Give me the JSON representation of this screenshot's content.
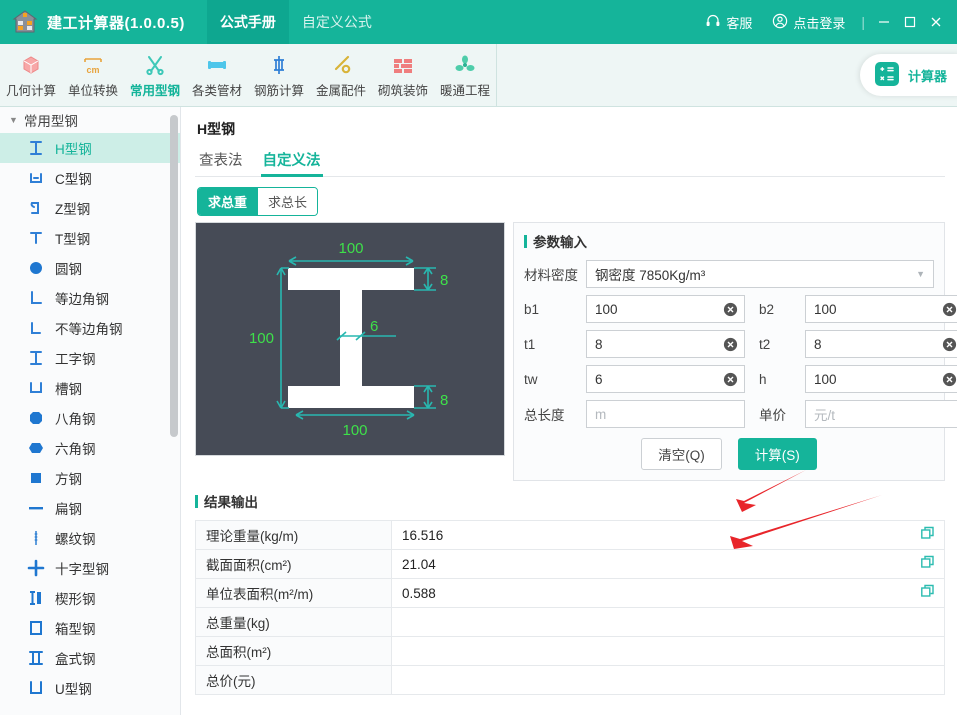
{
  "titlebar": {
    "app_title": "建工计算器(1.0.0.5)",
    "logo_icon": "house-logo-icon",
    "tabs": [
      {
        "label": "公式手册",
        "active": true
      },
      {
        "label": "自定义公式",
        "active": false
      }
    ],
    "support_label": "客服",
    "support_icon": "headset-icon",
    "login_label": "点击登录",
    "login_icon": "user-circle-icon",
    "separator": "|",
    "minimize_icon": "minimize-icon",
    "maximize_icon": "maximize-icon",
    "close_icon": "close-icon",
    "bg_color": "#15b49a"
  },
  "ribbon": {
    "items": [
      {
        "label": "几何计算",
        "icon": "cube-icon",
        "active": false
      },
      {
        "label": "单位转换",
        "icon": "cm-unit-icon",
        "active": false
      },
      {
        "label": "常用型钢",
        "icon": "wrench-scissors-icon",
        "active": true
      },
      {
        "label": "各类管材",
        "icon": "pipe-icon",
        "active": false
      },
      {
        "label": "钢筋计算",
        "icon": "rebar-icon",
        "active": false
      },
      {
        "label": "金属配件",
        "icon": "hammer-icon",
        "active": false
      },
      {
        "label": "砌筑装饰",
        "icon": "brick-wall-icon",
        "active": false
      },
      {
        "label": "暖通工程",
        "icon": "fan-icon",
        "active": false
      }
    ],
    "calculator_label": "计算器",
    "calculator_icon": "calculator-icon",
    "accent_color": "#15b49a"
  },
  "sidebar": {
    "root_label": "常用型钢",
    "caret_icon": "caret-down-icon",
    "items": [
      {
        "label": "H型钢",
        "icon": "h-beam-icon",
        "active": true
      },
      {
        "label": "C型钢",
        "icon": "c-channel-icon",
        "active": false
      },
      {
        "label": "Z型钢",
        "icon": "z-purlin-icon",
        "active": false
      },
      {
        "label": "T型钢",
        "icon": "t-beam-icon",
        "active": false
      },
      {
        "label": "圆钢",
        "icon": "circle-bar-icon",
        "active": false
      },
      {
        "label": "等边角钢",
        "icon": "equal-angle-icon",
        "active": false
      },
      {
        "label": "不等边角钢",
        "icon": "unequal-angle-icon",
        "active": false
      },
      {
        "label": "工字钢",
        "icon": "i-beam-icon",
        "active": false
      },
      {
        "label": "槽钢",
        "icon": "channel-icon",
        "active": false
      },
      {
        "label": "八角钢",
        "icon": "octagon-bar-icon",
        "active": false
      },
      {
        "label": "六角钢",
        "icon": "hexagon-bar-icon",
        "active": false
      },
      {
        "label": "方钢",
        "icon": "square-bar-icon",
        "active": false
      },
      {
        "label": "扁钢",
        "icon": "flat-bar-icon",
        "active": false
      },
      {
        "label": "螺纹钢",
        "icon": "rebar-thread-icon",
        "active": false
      },
      {
        "label": "十字型钢",
        "icon": "cross-section-icon",
        "active": false
      },
      {
        "label": "楔形钢",
        "icon": "wedge-steel-icon",
        "active": false
      },
      {
        "label": "箱型钢",
        "icon": "box-section-icon",
        "active": false
      },
      {
        "label": "盒式钢",
        "icon": "double-t-icon",
        "active": false
      },
      {
        "label": "U型钢",
        "icon": "u-section-icon",
        "active": false
      }
    ]
  },
  "content": {
    "page_title": "H型钢",
    "subtabs": [
      {
        "label": "查表法",
        "active": false
      },
      {
        "label": "自定义法",
        "active": true
      }
    ],
    "segments": [
      {
        "label": "求总重",
        "active": true
      },
      {
        "label": "求总长",
        "active": false
      }
    ]
  },
  "figure": {
    "name": "h-beam-cross-section-diagram",
    "dim_top_width": "100",
    "dim_top_thickness": "8",
    "dim_height": "100",
    "dim_web": "6",
    "dim_bottom_thickness": "8",
    "dim_bottom_width": "100",
    "bg_color": "#464b56",
    "shape_color": "#ffffff",
    "dim_line_color": "#28b8b0",
    "dim_text_color": "#3ee04a"
  },
  "params": {
    "title": "参数输入",
    "density_label": "材料密度",
    "density_value": "钢密度 7850Kg/m³",
    "dropdown_icon": "chevron-down-icon",
    "clear_icon": "clear-circle-icon",
    "fields": [
      {
        "label": "b1",
        "value": "100",
        "placeholder": "",
        "clearable": true
      },
      {
        "label": "b2",
        "value": "100",
        "placeholder": "",
        "clearable": true
      },
      {
        "label": "t1",
        "value": "8",
        "placeholder": "",
        "clearable": true
      },
      {
        "label": "t2",
        "value": "8",
        "placeholder": "",
        "clearable": true
      },
      {
        "label": "tw",
        "value": "6",
        "placeholder": "",
        "clearable": true
      },
      {
        "label": "h",
        "value": "100",
        "placeholder": "",
        "clearable": true
      },
      {
        "label": "总长度",
        "value": "",
        "placeholder": "m",
        "clearable": false
      },
      {
        "label": "单价",
        "value": "",
        "placeholder": "元/t",
        "clearable": false
      }
    ],
    "clear_button": "清空(Q)",
    "calc_button": "计算(S)"
  },
  "results": {
    "title": "结果输出",
    "copy_icon": "copy-icon",
    "rows": [
      {
        "key": "理论重量(kg/m)",
        "value": "16.516",
        "copyable": true
      },
      {
        "key": "截面面积(cm²)",
        "value": "21.04",
        "copyable": true
      },
      {
        "key": "单位表面积(m²/m)",
        "value": "0.588",
        "copyable": true
      },
      {
        "key": "总重量(kg)",
        "value": "",
        "copyable": false
      },
      {
        "key": "总面积(m²)",
        "value": "",
        "copyable": false
      },
      {
        "key": "总价(元)",
        "value": "",
        "copyable": false
      }
    ]
  },
  "annotations": {
    "arrow_color": "#e8252a",
    "arrows": [
      "arrow-to-theoretical-weight",
      "arrow-to-section-area"
    ]
  }
}
